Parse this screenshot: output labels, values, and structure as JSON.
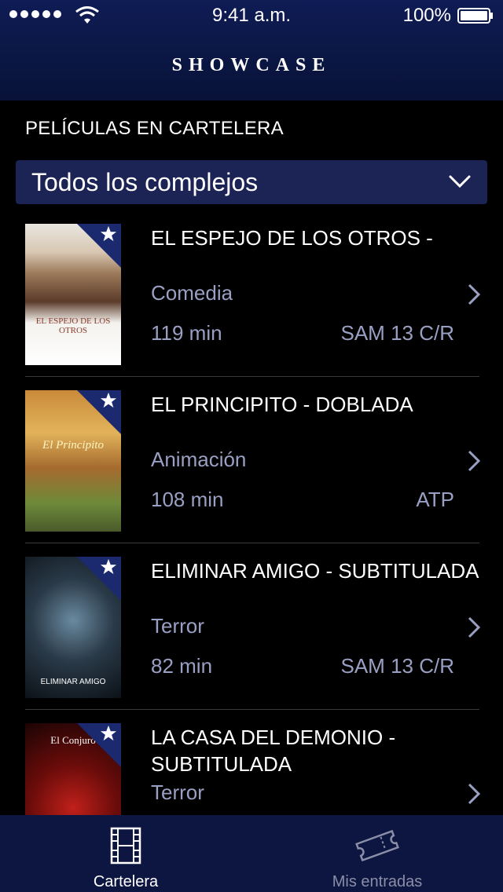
{
  "status_bar": {
    "time": "9:41 a.m.",
    "battery": "100%"
  },
  "header": {
    "brand": "SHOWCASE"
  },
  "section_title": "PELÍCULAS EN CARTELERA",
  "complex_selector": {
    "value": "Todos los complejos"
  },
  "movies": [
    {
      "title": "EL ESPEJO DE LOS OTROS -",
      "genre": "Comedia",
      "duration": "119 min",
      "rating": "SAM 13 C/R",
      "poster_text": "EL ESPEJO DE LOS OTROS"
    },
    {
      "title": "EL PRINCIPITO - DOBLADA",
      "genre": "Animación",
      "duration": "108 min",
      "rating": "ATP",
      "poster_text": "El Principito"
    },
    {
      "title": "ELIMINAR AMIGO - SUBTITULADA",
      "genre": "Terror",
      "duration": "82 min",
      "rating": "SAM 13 C/R",
      "poster_text": "ELIMINAR AMIGO"
    },
    {
      "title": "LA CASA DEL DEMONIO - SUBTITULADA",
      "genre": "Terror",
      "duration": "",
      "rating": "",
      "poster_text": "El Conjuro"
    }
  ],
  "tabbar": {
    "tabs": [
      {
        "label": "Cartelera",
        "icon": "film-icon",
        "active": true
      },
      {
        "label": "Mis entradas",
        "icon": "ticket-icon",
        "active": false
      }
    ]
  },
  "colors": {
    "header": "#0f1c55",
    "selector": "#1c2355",
    "tabbar": "#0d1640",
    "secondary_text": "#9aa0c4"
  }
}
